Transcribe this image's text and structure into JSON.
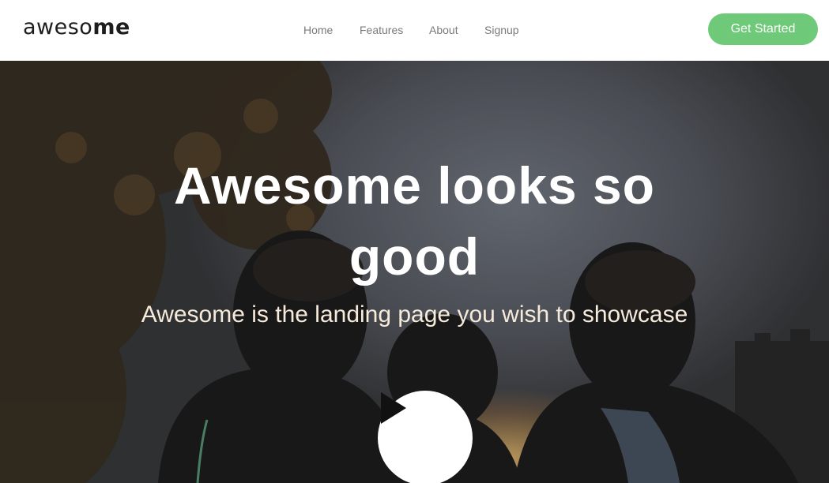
{
  "header": {
    "logo_light": "aweso",
    "logo_bold": "me",
    "nav": [
      {
        "label": "Home"
      },
      {
        "label": "Features"
      },
      {
        "label": "About"
      },
      {
        "label": "Signup"
      }
    ],
    "cta_label": "Get Started"
  },
  "hero": {
    "headline": "Awesome looks so good",
    "subline": "Awesome is the landing page you wish to showcase",
    "play_icon": "play-icon"
  },
  "colors": {
    "accent": "#6ec979",
    "logo": "#1d1d1d",
    "nav_text": "#7a7a7a",
    "headline": "#ffffff",
    "subline": "#f6eadb"
  }
}
